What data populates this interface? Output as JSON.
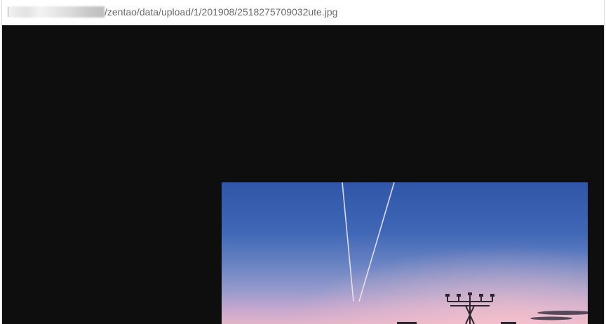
{
  "address_bar": {
    "url": "/zentao/data/upload/1/201908/2518275709032ute.jpg"
  },
  "icons": {
    "photo": "sky-photo-icon"
  },
  "colors": {
    "viewer_background": "#0e0e0e",
    "url_text": "#6a6a6a"
  }
}
